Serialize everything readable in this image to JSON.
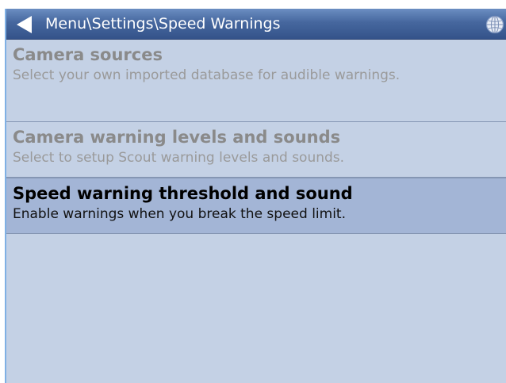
{
  "header": {
    "path": "Menu\\Settings\\Speed Warnings",
    "back_icon": "back-arrow-icon",
    "globe_icon": "globe-icon"
  },
  "items": [
    {
      "title": "Camera sources",
      "description": "Select your own imported database for audible warnings.",
      "state": "disabled"
    },
    {
      "title": "Camera warning levels and sounds",
      "description": "Select to setup Scout warning levels and sounds.",
      "state": "disabled"
    },
    {
      "title": "Speed warning threshold and sound",
      "description": "Enable warnings when you break the speed limit.",
      "state": "selected"
    }
  ],
  "colors": {
    "background": "#c4d1e5",
    "titlebar": "#46679e",
    "selected_row": "#a3b5d6",
    "disabled_text": "#8a8a8a"
  }
}
